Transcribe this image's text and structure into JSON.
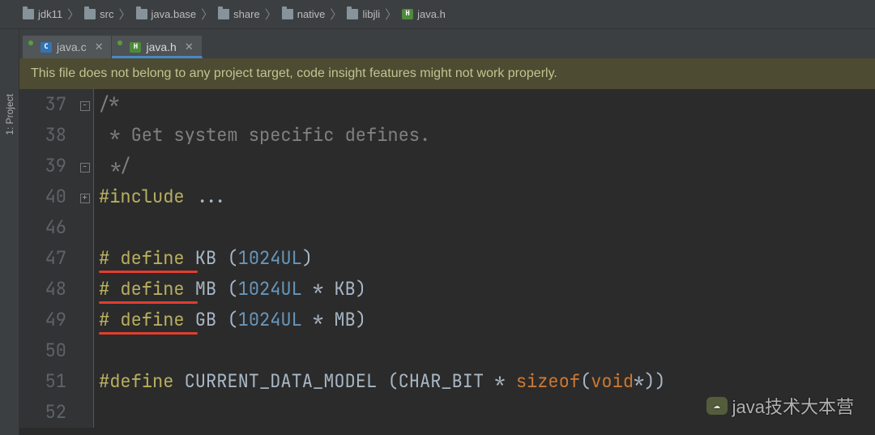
{
  "breadcrumbs": [
    "jdk11",
    "src",
    "java.base",
    "share",
    "native",
    "libjli",
    "java.h"
  ],
  "tabs": [
    {
      "icon": "C",
      "label": "java.c",
      "active": false
    },
    {
      "icon": "H",
      "label": "java.h",
      "active": true
    }
  ],
  "sideTool": {
    "label": "1: Project"
  },
  "banner": "This file does not belong to any project target, code insight features might not work properly.",
  "code": {
    "lines": [
      {
        "n": 37,
        "fold": "⊟",
        "tokens": [
          {
            "t": "/*",
            "c": "cmt"
          }
        ]
      },
      {
        "n": 38,
        "tokens": [
          {
            "t": " * Get system specific defines.",
            "c": "cmt"
          }
        ]
      },
      {
        "n": 39,
        "fold": "⊟",
        "tokens": [
          {
            "t": " */",
            "c": "cmt"
          }
        ]
      },
      {
        "n": 40,
        "fold": "⊞",
        "tokens": [
          {
            "t": "#include ",
            "c": "pp"
          },
          {
            "t": "...",
            "c": "sym"
          }
        ]
      },
      {
        "n": 46,
        "tokens": []
      },
      {
        "n": 47,
        "underline": true,
        "tokens": [
          {
            "t": "# ",
            "c": "pp"
          },
          {
            "t": "define",
            "c": "pp"
          },
          {
            "t": " KB (",
            "c": "sym"
          },
          {
            "t": "1024UL",
            "c": "num"
          },
          {
            "t": ")",
            "c": "sym"
          }
        ]
      },
      {
        "n": 48,
        "underline": true,
        "tokens": [
          {
            "t": "# ",
            "c": "pp"
          },
          {
            "t": "define",
            "c": "pp"
          },
          {
            "t": " MB (",
            "c": "sym"
          },
          {
            "t": "1024UL",
            "c": "num"
          },
          {
            "t": " * KB)",
            "c": "sym"
          }
        ]
      },
      {
        "n": 49,
        "underline": true,
        "tokens": [
          {
            "t": "# ",
            "c": "pp"
          },
          {
            "t": "define",
            "c": "pp"
          },
          {
            "t": " GB (",
            "c": "sym"
          },
          {
            "t": "1024UL",
            "c": "num"
          },
          {
            "t": " * MB)",
            "c": "sym"
          }
        ]
      },
      {
        "n": 50,
        "tokens": []
      },
      {
        "n": 51,
        "tokens": [
          {
            "t": "#define",
            "c": "pp"
          },
          {
            "t": " CURRENT_DATA_MODEL (CHAR_BIT * ",
            "c": "sym"
          },
          {
            "t": "sizeof",
            "c": "sizeof"
          },
          {
            "t": "(",
            "c": "sym"
          },
          {
            "t": "void",
            "c": "void"
          },
          {
            "t": "*))",
            "c": "sym"
          }
        ]
      },
      {
        "n": 52,
        "tokens": []
      }
    ]
  },
  "watermark": "java技术大本营"
}
